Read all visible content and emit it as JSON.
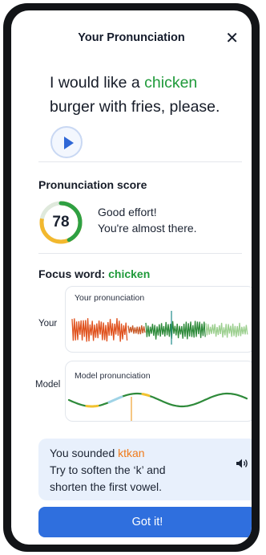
{
  "header": {
    "title": "Your Pronunciation",
    "close_icon": "close-icon"
  },
  "sentence": {
    "before": "I would like a ",
    "highlight": "chicken",
    "after": " burger with fries, please."
  },
  "score": {
    "label": "Pronunciation score",
    "value": "78",
    "value_fraction": 0.78,
    "feedback_line1": "Good effort!",
    "feedback_line2": "You're almost there."
  },
  "focus": {
    "label": "Focus word: ",
    "word": "chicken"
  },
  "waveforms": {
    "your": {
      "row_label": "Your",
      "caption": "Your pronunciation"
    },
    "model": {
      "row_label": "Model",
      "caption": "Model pronunciation"
    }
  },
  "tip": {
    "prefix": "You sounded ",
    "sounded": "ktkan",
    "line2": "Try to soften the ‘k’ and",
    "line3": "shorten the first vowel."
  },
  "cta": {
    "label": "Got it!"
  },
  "colors": {
    "accent": "#2f6fde",
    "green": "#1f9a3a",
    "orange": "#f07a1a",
    "ring_yellow": "#f2b82e",
    "tip_bg": "#e8f0fc"
  },
  "icons": {
    "play": "play-icon",
    "speaker": "speaker-icon"
  }
}
